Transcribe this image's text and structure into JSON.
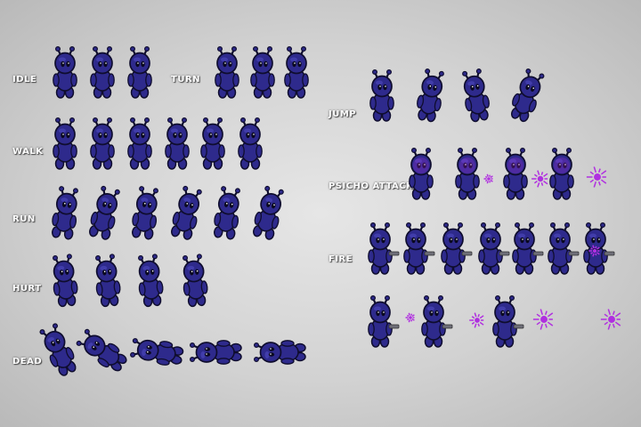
{
  "animations": {
    "idle": {
      "label": "IDLE",
      "frames": 3
    },
    "turn": {
      "label": "TURN",
      "frames": 3
    },
    "walk": {
      "label": "WALK",
      "frames": 6
    },
    "run": {
      "label": "RUN",
      "frames": 6
    },
    "hurt": {
      "label": "HURT",
      "frames": 4
    },
    "dead": {
      "label": "DEAD",
      "frames": 5
    },
    "jump": {
      "label": "JUMP",
      "frames": 4
    },
    "psycho_attack": {
      "label": "PSICHO ATTACK",
      "frames": 4
    },
    "fire": {
      "label": "FIRE",
      "frames": 7
    },
    "fire_projectile": {
      "label": "",
      "frames": 6
    }
  },
  "colors": {
    "alien_body": "#2e2a8c",
    "alien_outline": "#0f0d2e",
    "alien_highlight": "#4a46b8",
    "psychic_glow": "#b02fe0",
    "gun": "#6e6e78"
  }
}
